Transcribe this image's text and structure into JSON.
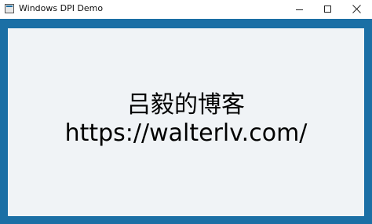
{
  "window": {
    "title": "Windows DPI Demo",
    "controls": {
      "minimize": "minimize-icon",
      "maximize": "maximize-icon",
      "close": "close-icon"
    },
    "border_color": "#1b6fa5",
    "content_background": "#f0f3f6"
  },
  "content": {
    "line1": "吕毅的博客",
    "line2": "https://walterlv.com/"
  }
}
